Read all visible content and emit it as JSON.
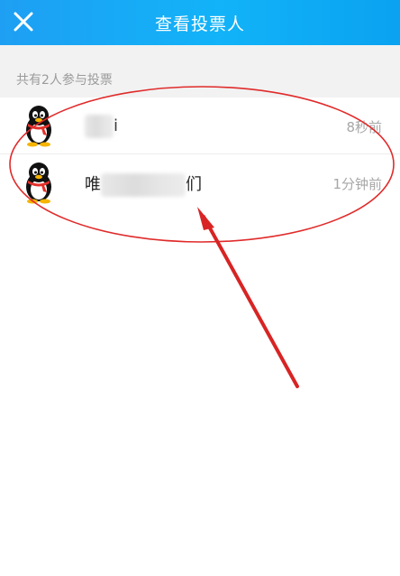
{
  "header": {
    "title": "查看投票人",
    "close_icon": "close-icon"
  },
  "section": {
    "voters_count_text": "共有2人参与投票"
  },
  "voters": [
    {
      "name_suffix": "i",
      "time": "8秒前",
      "avatar_icon": "qq-penguin-icon"
    },
    {
      "name_prefix": "唯",
      "name_suffix": "们",
      "time": "1分钟前",
      "avatar_icon": "qq-penguin-icon"
    }
  ],
  "colors": {
    "header_bg": "#12b3f8",
    "section_bg": "#f2f2f2",
    "annotation_red": "#e02b2b"
  }
}
